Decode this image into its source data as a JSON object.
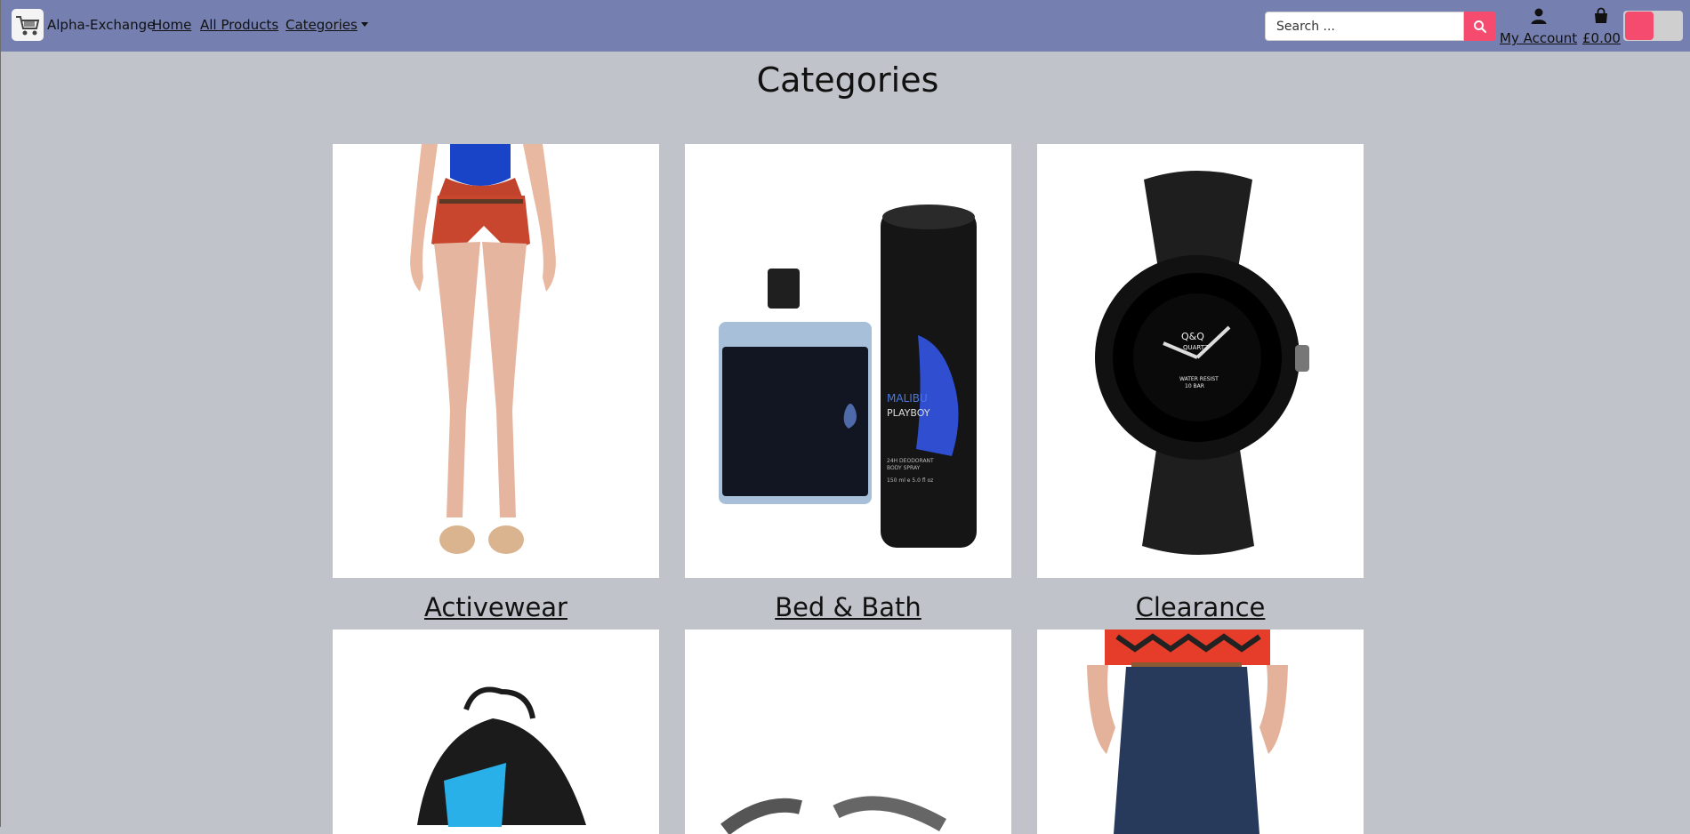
{
  "header": {
    "brand": "Alpha-Exchange",
    "nav": {
      "home": "Home",
      "all_products": "All Products",
      "categories": "Categories"
    },
    "search": {
      "placeholder": "Search ..."
    },
    "account_label": "My Account",
    "cart_total": "£0.00",
    "accent_color": "#f44b6f",
    "bar_color": "#7580b0"
  },
  "main": {
    "title": "Categories",
    "categories": [
      {
        "label": "Activewear",
        "image": "red-shorts-model"
      },
      {
        "label": "Bed & Bath",
        "image": "perfume-and-deodorant"
      },
      {
        "label": "Clearance",
        "image": "black-sport-watch"
      },
      {
        "label": "",
        "image": "drawstring-bag"
      },
      {
        "label": "",
        "image": "metal-bracelets"
      },
      {
        "label": "",
        "image": "jeans-model"
      }
    ],
    "product_text": {
      "deo_brand": "MALIBU",
      "deo_name": "PLAYBOY",
      "deo_type": "24H DEODORANT",
      "deo_sub": "BODY SPRAY",
      "deo_size": "150 ml e 5.0 fl oz",
      "watch_brand": "Q&Q",
      "watch_sub": "QUARTZ",
      "watch_resist": "WATER RESIST",
      "watch_bar": "10 BAR"
    }
  }
}
